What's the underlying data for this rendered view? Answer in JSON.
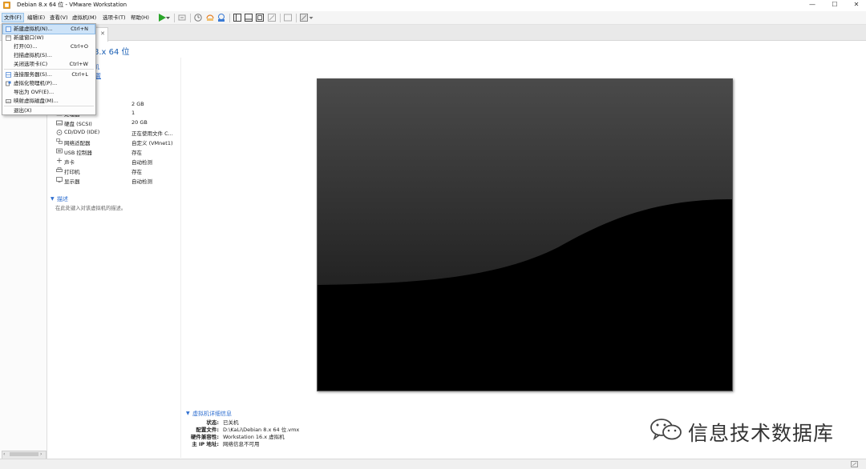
{
  "window": {
    "title": "Debian 8.x 64 位 - VMware Workstation",
    "minimize": "—",
    "maximize": "☐",
    "close": "✕"
  },
  "menubar": {
    "items": [
      {
        "label": "文件(F)"
      },
      {
        "label": "编辑(E)"
      },
      {
        "label": "查看(V)"
      },
      {
        "label": "虚拟机(M)"
      },
      {
        "label": "选项卡(T)"
      },
      {
        "label": "帮助(H)"
      }
    ]
  },
  "toolbar": {
    "icons": [
      "power-on-icon",
      "dropdown-arrow-icon",
      "send-ctrl-alt-del-icon",
      "snapshot-icon",
      "revert-snapshot-icon",
      "snapshot-manager-icon",
      "library-view-icon",
      "thumbnail-view-icon",
      "fullscreen-icon",
      "unity-icon",
      "console-view-icon",
      "stretch-view-icon"
    ]
  },
  "file_menu": {
    "items": [
      {
        "label": "新建虚拟机(N)...",
        "shortcut": "Ctrl+N",
        "highlighted": true
      },
      {
        "label": "新建窗口(W)",
        "shortcut": ""
      },
      {
        "label": "打开(O)...",
        "shortcut": "Ctrl+O"
      },
      {
        "label": "扫描虚拟机(S)...",
        "shortcut": ""
      },
      {
        "label": "关闭选项卡(C)",
        "shortcut": "Ctrl+W"
      },
      {
        "label": "连接服务器(S)...",
        "shortcut": "Ctrl+L"
      },
      {
        "label": "虚拟化物理机(P)...",
        "shortcut": ""
      },
      {
        "label": "导出为 OVF(E)...",
        "shortcut": ""
      },
      {
        "label": "映射虚拟磁盘(M)...",
        "shortcut": ""
      },
      {
        "label": "退出(X)",
        "shortcut": ""
      }
    ]
  },
  "vm": {
    "title_fragment": "8.x 64 位",
    "link_fragment_1": "机",
    "link_fragment_2": "置"
  },
  "devices": [
    {
      "name": "",
      "value": "2 GB",
      "icon": "memory-icon"
    },
    {
      "name": "处理器",
      "value": "1",
      "icon": "processor-icon"
    },
    {
      "name": "硬盘 (SCSI)",
      "value": "20 GB",
      "icon": "hard-disk-icon"
    },
    {
      "name": "CD/DVD (IDE)",
      "value": "正在使用文件 C...",
      "icon": "cd-dvd-icon"
    },
    {
      "name": "网络适配器",
      "value": "自定义 (VMnet1)",
      "icon": "network-adapter-icon"
    },
    {
      "name": "USB 控制器",
      "value": "存在",
      "icon": "usb-controller-icon"
    },
    {
      "name": "声卡",
      "value": "自动检测",
      "icon": "sound-card-icon"
    },
    {
      "name": "打印机",
      "value": "存在",
      "icon": "printer-icon"
    },
    {
      "name": "显示器",
      "value": "自动检测",
      "icon": "display-icon"
    }
  ],
  "description": {
    "header": "描述",
    "placeholder": "在此处键入对该虚拟机的描述。"
  },
  "details": {
    "header": "虚拟机详细信息",
    "rows": [
      {
        "label": "状态:",
        "value": "已关机"
      },
      {
        "label": "配置文件:",
        "value": "D:\\KaLi\\Debian 8.x 64 位.vmx"
      },
      {
        "label": "硬件兼容性:",
        "value": "Workstation 16.x 虚拟机"
      },
      {
        "label": "主 IP 地址:",
        "value": "网络信息不可用"
      }
    ]
  },
  "watermark": {
    "text": "信息技术数据库"
  },
  "colors": {
    "accent": "#1a5fb4",
    "menu_highlight": "#cde3f8",
    "play_green": "#2aa52a"
  }
}
